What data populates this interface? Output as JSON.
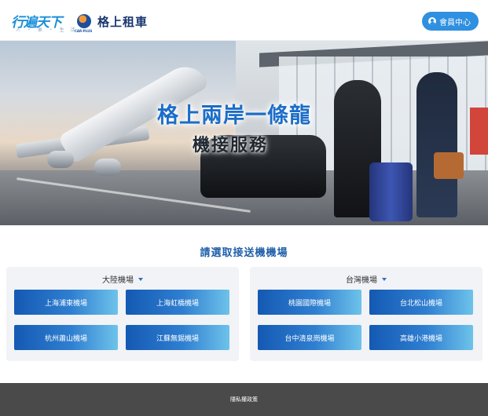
{
  "header": {
    "logo": {
      "brand": "行遍天下",
      "tagline": "人 ・ 車 ・ 生 活"
    },
    "partner": {
      "en": "CAR-PLUS",
      "name": "格上租車"
    },
    "member_button": {
      "label": "會員中心",
      "icon": "user-icon"
    }
  },
  "hero": {
    "title": "格上兩岸一條龍",
    "subtitle": "機接服務"
  },
  "main": {
    "section_title": "請選取接送機機場",
    "panels": [
      {
        "region": "大陸機場",
        "airports": [
          "上海浦東機場",
          "上海虹橋機場",
          "杭州蕭山機場",
          "江蘇無錫機場"
        ]
      },
      {
        "region": "台灣機場",
        "airports": [
          "桃園國際機場",
          "台北松山機場",
          "台中清泉崗機場",
          "高雄小港機場"
        ]
      }
    ]
  },
  "footer": {
    "privacy_link": "隱私權政策"
  },
  "colors": {
    "accent": "#2f8fe0",
    "title_blue": "#1f5fa8",
    "button_gradient_start": "#1459b3",
    "button_gradient_end": "#6ec3ea",
    "footer_bg": "#4a4a4a"
  }
}
